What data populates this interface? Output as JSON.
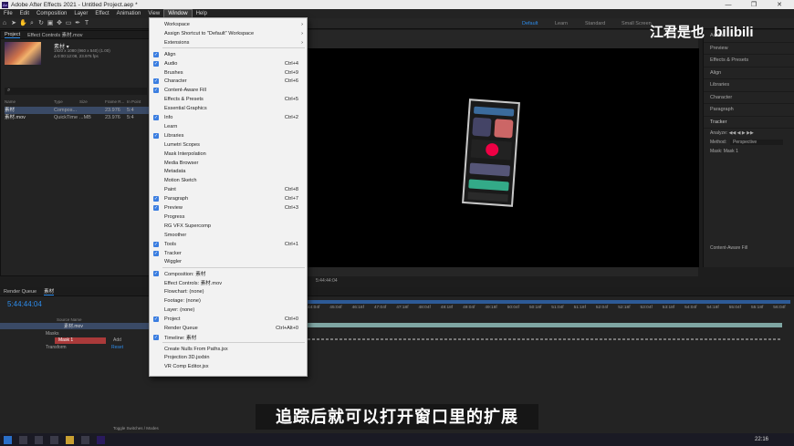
{
  "window": {
    "title": "Adobe After Effects 2021 - Untitled Project.aep *",
    "logo": "Ae"
  },
  "menubar": [
    "File",
    "Edit",
    "Composition",
    "Layer",
    "Effect",
    "Animation",
    "View",
    "Window",
    "Help"
  ],
  "workspaces": [
    "Default",
    "Learn",
    "Standard",
    "Small Screen"
  ],
  "project_panel": {
    "tabs": [
      "Project",
      "Effect Controls 素材.mov"
    ],
    "item_name": "素材 ▾",
    "item_info1": "1920 x 1080 (960 x 540) (1.00)",
    "item_info2": "Δ 0:00:12:08, 23.976 fps",
    "columns": [
      "Name",
      "Type",
      "Size",
      "Frame R...",
      "In Point"
    ],
    "rows": [
      {
        "name": "素材",
        "type": "Compos...",
        "size": "",
        "fps": "23.976",
        "in": "5:4"
      },
      {
        "name": "素材.mov",
        "type": "QuickTime",
        "size": "...MB",
        "fps": "23.976",
        "in": "5:4"
      }
    ]
  },
  "window_menu": {
    "items": [
      {
        "label": "Workspace",
        "checked": false,
        "shortcut": "",
        "submenu": true
      },
      {
        "label": "Assign Shortcut to \"Default\" Workspace",
        "checked": false,
        "shortcut": "",
        "submenu": true
      },
      {
        "label": "Extensions",
        "checked": false,
        "shortcut": "",
        "submenu": true
      },
      {
        "label": "Align",
        "checked": true,
        "shortcut": "",
        "submenu": false
      },
      {
        "label": "Audio",
        "checked": true,
        "shortcut": "Ctrl+4",
        "submenu": false
      },
      {
        "label": "Brushes",
        "checked": false,
        "shortcut": "Ctrl+9",
        "submenu": false
      },
      {
        "label": "Character",
        "checked": true,
        "shortcut": "Ctrl+6",
        "submenu": false
      },
      {
        "label": "Content-Aware Fill",
        "checked": true,
        "shortcut": "",
        "submenu": false
      },
      {
        "label": "Effects & Presets",
        "checked": false,
        "shortcut": "Ctrl+5",
        "submenu": false
      },
      {
        "label": "Essential Graphics",
        "checked": false,
        "shortcut": "",
        "submenu": false
      },
      {
        "label": "Info",
        "checked": true,
        "shortcut": "Ctrl+2",
        "submenu": false
      },
      {
        "label": "Learn",
        "checked": false,
        "shortcut": "",
        "submenu": false
      },
      {
        "label": "Libraries",
        "checked": true,
        "shortcut": "",
        "submenu": false
      },
      {
        "label": "Lumetri Scopes",
        "checked": false,
        "shortcut": "",
        "submenu": false
      },
      {
        "label": "Mask Interpolation",
        "checked": false,
        "shortcut": "",
        "submenu": false
      },
      {
        "label": "Media Browser",
        "checked": false,
        "shortcut": "",
        "submenu": false
      },
      {
        "label": "Metadata",
        "checked": false,
        "shortcut": "",
        "submenu": false
      },
      {
        "label": "Motion Sketch",
        "checked": false,
        "shortcut": "",
        "submenu": false
      },
      {
        "label": "Paint",
        "checked": false,
        "shortcut": "Ctrl+8",
        "submenu": false
      },
      {
        "label": "Paragraph",
        "checked": true,
        "shortcut": "Ctrl+7",
        "submenu": false
      },
      {
        "label": "Preview",
        "checked": true,
        "shortcut": "Ctrl+3",
        "submenu": false
      },
      {
        "label": "Progress",
        "checked": false,
        "shortcut": "",
        "submenu": false
      },
      {
        "label": "RG VFX Supercomp",
        "checked": false,
        "shortcut": "",
        "submenu": false
      },
      {
        "label": "Smoother",
        "checked": false,
        "shortcut": "",
        "submenu": false
      },
      {
        "label": "Tools",
        "checked": true,
        "shortcut": "Ctrl+1",
        "submenu": false
      },
      {
        "label": "Tracker",
        "checked": true,
        "shortcut": "",
        "submenu": false
      },
      {
        "label": "Wiggler",
        "checked": false,
        "shortcut": "",
        "submenu": false
      },
      {
        "label": "Composition: 素材",
        "checked": true,
        "shortcut": "",
        "submenu": false
      },
      {
        "label": "Effect Controls: 素材.mov",
        "checked": false,
        "shortcut": "",
        "submenu": false
      },
      {
        "label": "Flowchart: (none)",
        "checked": false,
        "shortcut": "",
        "submenu": false
      },
      {
        "label": "Footage: (none)",
        "checked": false,
        "shortcut": "",
        "submenu": false
      },
      {
        "label": "Layer: (none)",
        "checked": false,
        "shortcut": "",
        "submenu": false
      },
      {
        "label": "Project",
        "checked": true,
        "shortcut": "Ctrl+0",
        "submenu": false
      },
      {
        "label": "Render Queue",
        "checked": false,
        "shortcut": "Ctrl+Alt+0",
        "submenu": false
      },
      {
        "label": "Timeline: 素材",
        "checked": true,
        "shortcut": "",
        "submenu": false
      },
      {
        "label": "Create Nulls From Paths.jsx",
        "checked": false,
        "shortcut": "",
        "submenu": false
      },
      {
        "label": "Projection 3D.jsxbin",
        "checked": false,
        "shortcut": "",
        "submenu": false
      },
      {
        "label": "VR Comp Editor.jsx",
        "checked": false,
        "shortcut": "",
        "submenu": false
      }
    ]
  },
  "right_panel": {
    "items": [
      "Audio",
      "Preview",
      "Effects & Presets",
      "Align",
      "Libraries",
      "Character",
      "Paragraph"
    ],
    "tracker": {
      "title": "Tracker",
      "analyze_label": "Analyze:",
      "method_label": "Method:",
      "method_value": "Perspective",
      "mask_label": "Mask:",
      "mask_value": "Mask 1"
    },
    "content_aware": "Content-Aware Fill"
  },
  "composition": {
    "timecode_small": "5:44:44:04"
  },
  "timeline": {
    "tabs": [
      "Render Queue",
      "素材"
    ],
    "timecode": "5:44:44:04",
    "columns": [
      "Source Name"
    ],
    "layer": "素材.mov",
    "masks_label": "Masks",
    "mask1": "Mask 1",
    "mask_mode": "Add",
    "transform": "Transform",
    "reset": "Reset",
    "toggle_label": "Toggle Switches / Modes",
    "ruler": [
      "44:04f",
      "45:04f",
      "46:16f",
      "47:04f",
      "47:18f",
      "48:04f",
      "48:18f",
      "49:04f",
      "49:18f",
      "50:04f",
      "50:18f",
      "51:04f",
      "51:18f",
      "52:04f",
      "52:18f",
      "53:04f",
      "53:18f",
      "54:04f",
      "54:18f",
      "55:04f",
      "55:18f",
      "56:04f"
    ]
  },
  "overlay": {
    "subtitle": "追踪后就可以打开窗口里的扩展",
    "watermark": "江君是也",
    "watermark_brand": "bilibili"
  },
  "taskbar": {
    "time": "22:16"
  },
  "colors": {
    "accent": "#2d8ceb",
    "check": "#3a7de0",
    "menu_bg": "#f2f2f2"
  }
}
